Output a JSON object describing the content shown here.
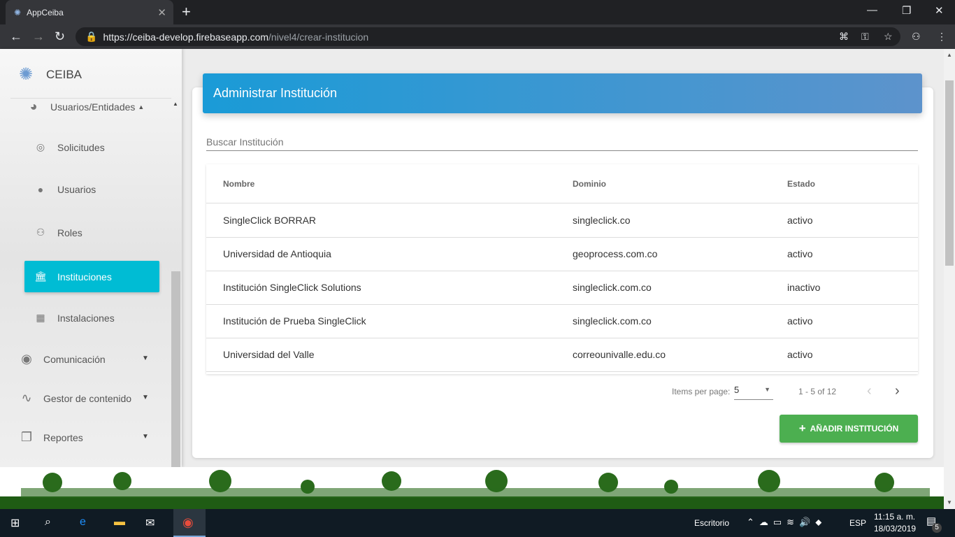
{
  "browser": {
    "tab_title": "AppCeiba",
    "url_host": "https://ceiba-develop.firebaseapp.com",
    "url_path": "/nivel4/crear-institucion"
  },
  "sidebar": {
    "brand": "CEIBA",
    "group": "Usuarios/Entidades",
    "sub_items": [
      {
        "label": "Solicitudes",
        "icon": "check-circle-icon"
      },
      {
        "label": "Usuarios",
        "icon": "account-circle-icon"
      },
      {
        "label": "Roles",
        "icon": "people-icon"
      },
      {
        "label": "Instituciones",
        "icon": "bank-icon",
        "active": true
      },
      {
        "label": "Instalaciones",
        "icon": "building-icon"
      }
    ],
    "items": [
      {
        "label": "Comunicación",
        "icon": "record-voice-icon"
      },
      {
        "label": "Gestor de contenido",
        "icon": "gesture-icon"
      },
      {
        "label": "Reportes",
        "icon": "file-copy-icon"
      }
    ]
  },
  "main": {
    "title": "Administrar Institución",
    "search_placeholder": "Buscar Institución",
    "columns": [
      "Nombre",
      "Dominio",
      "Estado"
    ],
    "rows": [
      [
        "SingleClick BORRAR",
        "singleclick.co",
        "activo"
      ],
      [
        "Universidad de Antioquia",
        "geoprocess.com.co",
        "activo"
      ],
      [
        "Institución SingleClick Solutions",
        "singleclick.com.co",
        "inactivo"
      ],
      [
        "Institución de Prueba SingleClick",
        "singleclick.com.co",
        "activo"
      ],
      [
        "Universidad del Valle",
        "correounivalle.edu.co",
        "activo"
      ]
    ],
    "paginator": {
      "items_label": "Items per page:",
      "page_size": "5",
      "range": "1 - 5 of 12"
    },
    "add_button": "AÑADIR INSTITUCIÓN"
  },
  "taskbar": {
    "desktop": "Escritorio",
    "lang": "ESP",
    "time": "11:15 a. m.",
    "date": "18/03/2019",
    "notifications": "5"
  },
  "colors": {
    "header": "#1a9bd7",
    "active": "#00bcd4",
    "button": "#4caf50"
  }
}
